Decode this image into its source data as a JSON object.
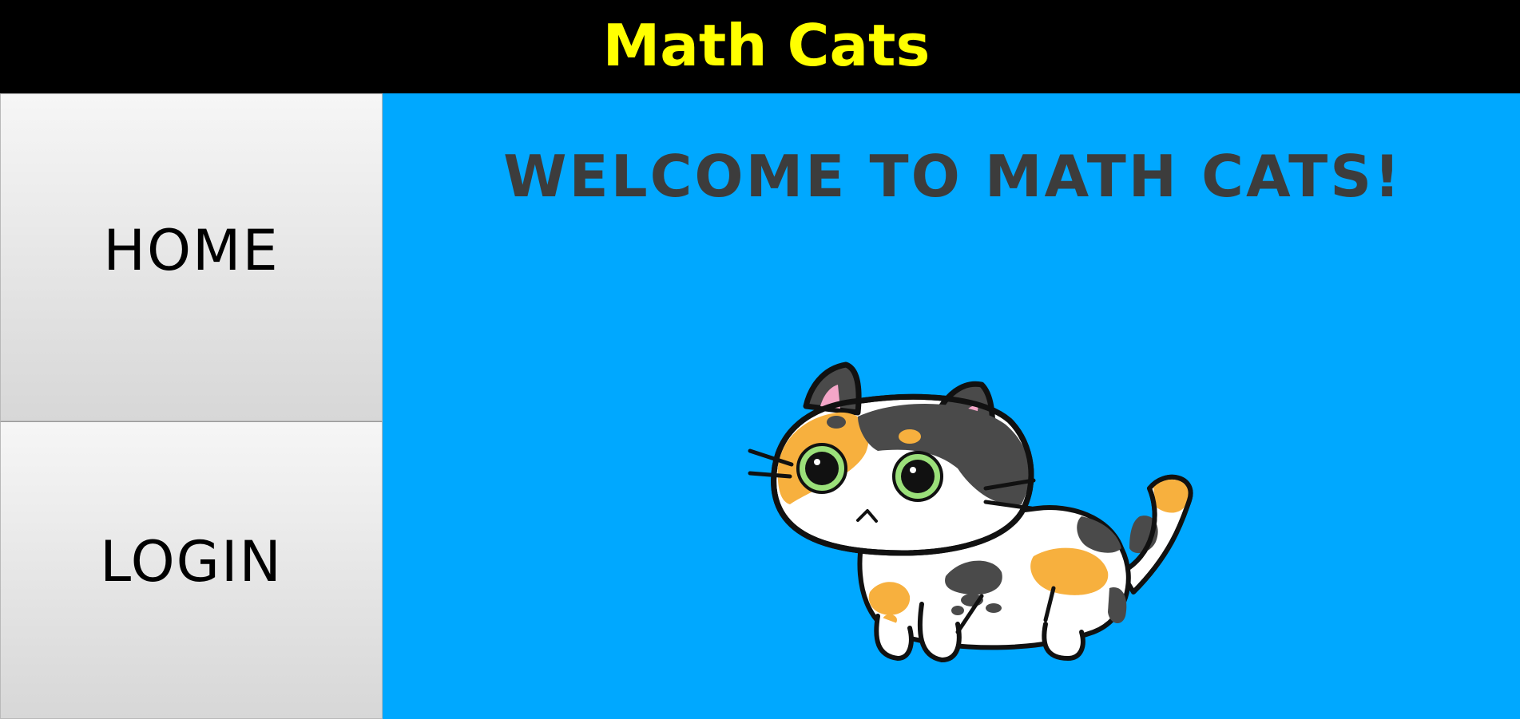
{
  "header": {
    "title": "Math Cats"
  },
  "sidebar": {
    "items": [
      {
        "label": "HOME"
      },
      {
        "label": "LOGIN"
      }
    ]
  },
  "main": {
    "heading": "WELCOME TO MATH CATS!",
    "image": "calico-cat-illustration"
  },
  "colors": {
    "header_bg": "#000000",
    "title_color": "#FFFF00",
    "main_bg": "#00A8FF",
    "heading_color": "#3C3C3C",
    "nav_bg_top": "#F6F6F6",
    "nav_bg_bottom": "#D7D7D7"
  }
}
